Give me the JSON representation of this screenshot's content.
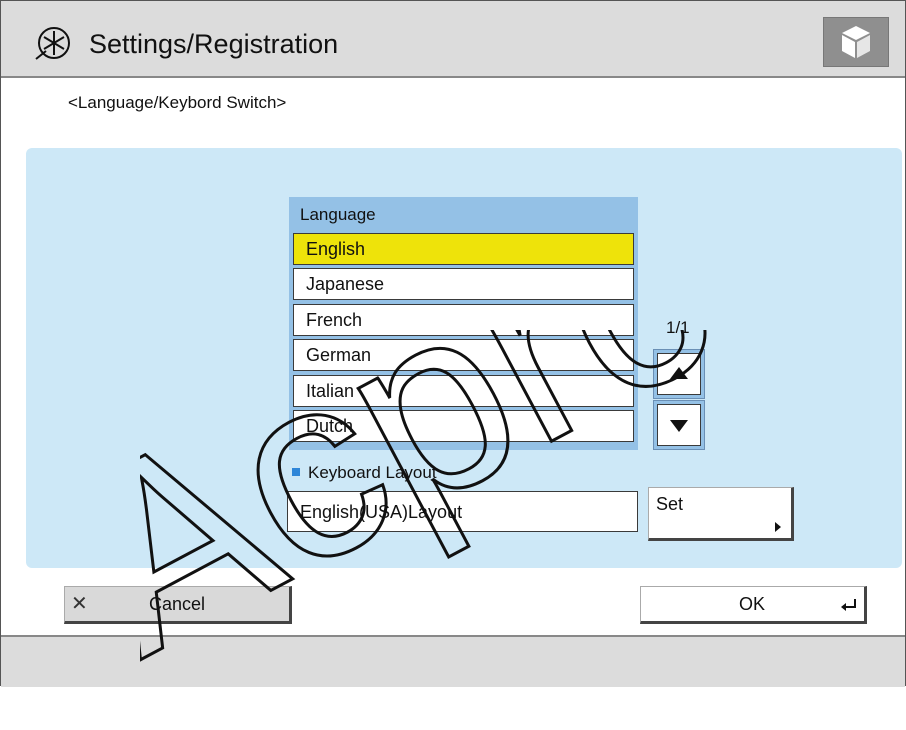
{
  "header": {
    "title": "Settings/Registration",
    "title_icon": "settings-asterisk-icon",
    "home_icon": "cube-icon"
  },
  "screen": {
    "subtitle": "<Language/Keybord Switch>"
  },
  "language_list": {
    "header": "Language",
    "items": [
      {
        "label": "English",
        "selected": true
      },
      {
        "label": "Japanese",
        "selected": false
      },
      {
        "label": "French",
        "selected": false
      },
      {
        "label": "German",
        "selected": false
      },
      {
        "label": "Italian",
        "selected": false
      },
      {
        "label": "Dutch",
        "selected": false
      }
    ],
    "page_indicator": "1/1"
  },
  "keyboard": {
    "label": "Keyboard Layout",
    "value": "English(USA)Layout",
    "set_label": "Set"
  },
  "actions": {
    "cancel_label": "Cancel",
    "ok_label": "OK"
  },
  "watermark": {
    "text": "Acprc O"
  },
  "colors": {
    "selected_row": "#eee30a",
    "panel_bg": "#cde8f7",
    "list_header_bg": "#94c1e6",
    "titlebar_bg": "#dcdcdc"
  }
}
